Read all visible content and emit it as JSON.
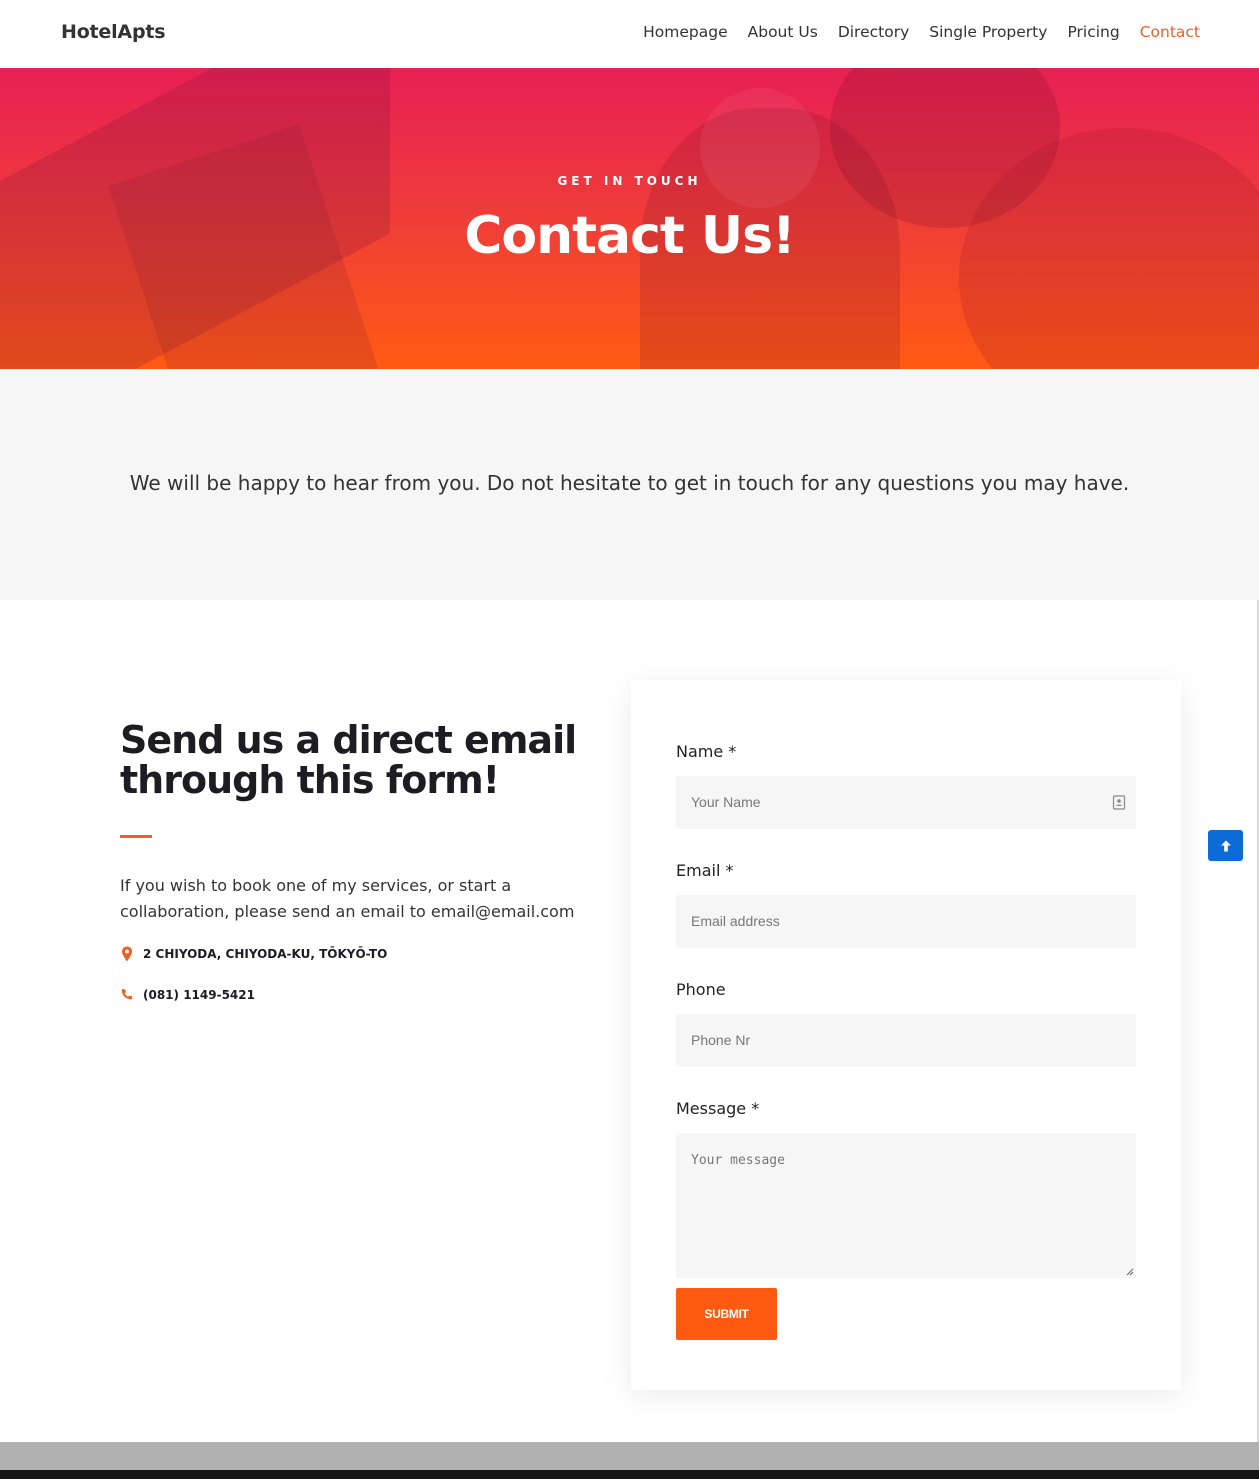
{
  "header": {
    "logo": "HotelApts",
    "nav": [
      "Homepage",
      "About Us",
      "Directory",
      "Single Property",
      "Pricing",
      "Contact"
    ],
    "active": "Contact"
  },
  "hero": {
    "eyebrow": "GET IN TOUCH",
    "title": "Contact Us!"
  },
  "intro": {
    "text": "We will be happy to hear from you. Do not hesitate to get in touch for any questions you may have."
  },
  "left": {
    "title": "Send us a direct email through this form!",
    "text": "If you wish to book one of my services, or start a collaboration, please send an email to email@email.com",
    "address": "2 CHIYODA, CHIYODA-KU, TŌKYŌ-TO",
    "phone": "(081) 1149-5421"
  },
  "form": {
    "name_label": "Name *",
    "name_placeholder": "Your Name",
    "email_label": "Email *",
    "email_placeholder": "Email address",
    "phone_label": "Phone",
    "phone_placeholder": "Phone Nr",
    "message_label": "Message *",
    "message_placeholder": "Your message",
    "submit_label": "SUBMIT"
  },
  "colors": {
    "accent": "#e8622a",
    "button": "#ff5a12",
    "scroll_top": "#0d6bd8"
  }
}
